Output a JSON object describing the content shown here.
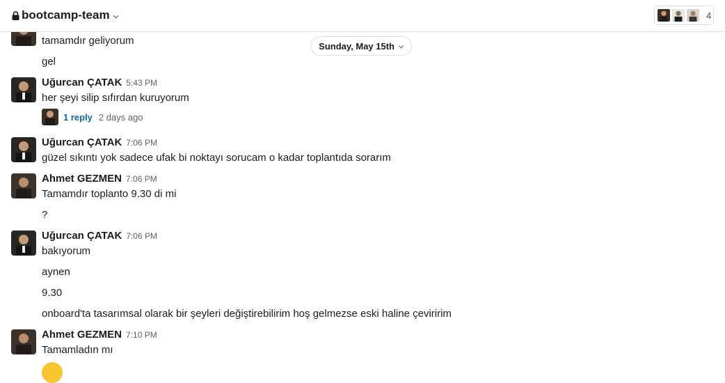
{
  "header": {
    "channel_name": "bootcamp-team",
    "member_count": "4",
    "icons": [
      "lock-icon",
      "chevron-down-icon"
    ]
  },
  "date_divider": {
    "label": "Sunday, May 15th"
  },
  "messages": [
    {
      "text": "tamamdır geliyorum"
    },
    {
      "text": "gel"
    },
    {
      "author": "Uğurcan ÇATAK",
      "time": "5:43 PM",
      "text": "her şeyi silip sıfırdan kuruyorum"
    },
    {
      "author": "Uğurcan ÇATAK",
      "time": "7:06 PM",
      "text": "güzel sıkıntı yok sadece ufak bi noktayı sorucam o kadar toplantıda sorarım"
    },
    {
      "author": "Ahmet GEZMEN",
      "time": "7:06 PM",
      "text": "Tamamdır toplanto 9.30 di mi"
    },
    {
      "text": "?"
    },
    {
      "author": "Uğurcan ÇATAK",
      "time": "7:06 PM",
      "text": "bakıyorum"
    },
    {
      "text": "aynen"
    },
    {
      "text": "9.30"
    },
    {
      "text": "onboard'ta tasarımsal olarak bir şeyleri değiştirebilirim hoş gelmezse eski haline çeviririm"
    },
    {
      "author": "Ahmet GEZMEN",
      "time": "7:10 PM",
      "text": "Tamamladın mı"
    }
  ],
  "thread": {
    "reply_count": "1 reply",
    "last_reply": "2 days ago"
  },
  "colors": {
    "link": "#1264a3",
    "text": "#1d1c1d",
    "muted": "#616061",
    "border": "#dddddd"
  }
}
